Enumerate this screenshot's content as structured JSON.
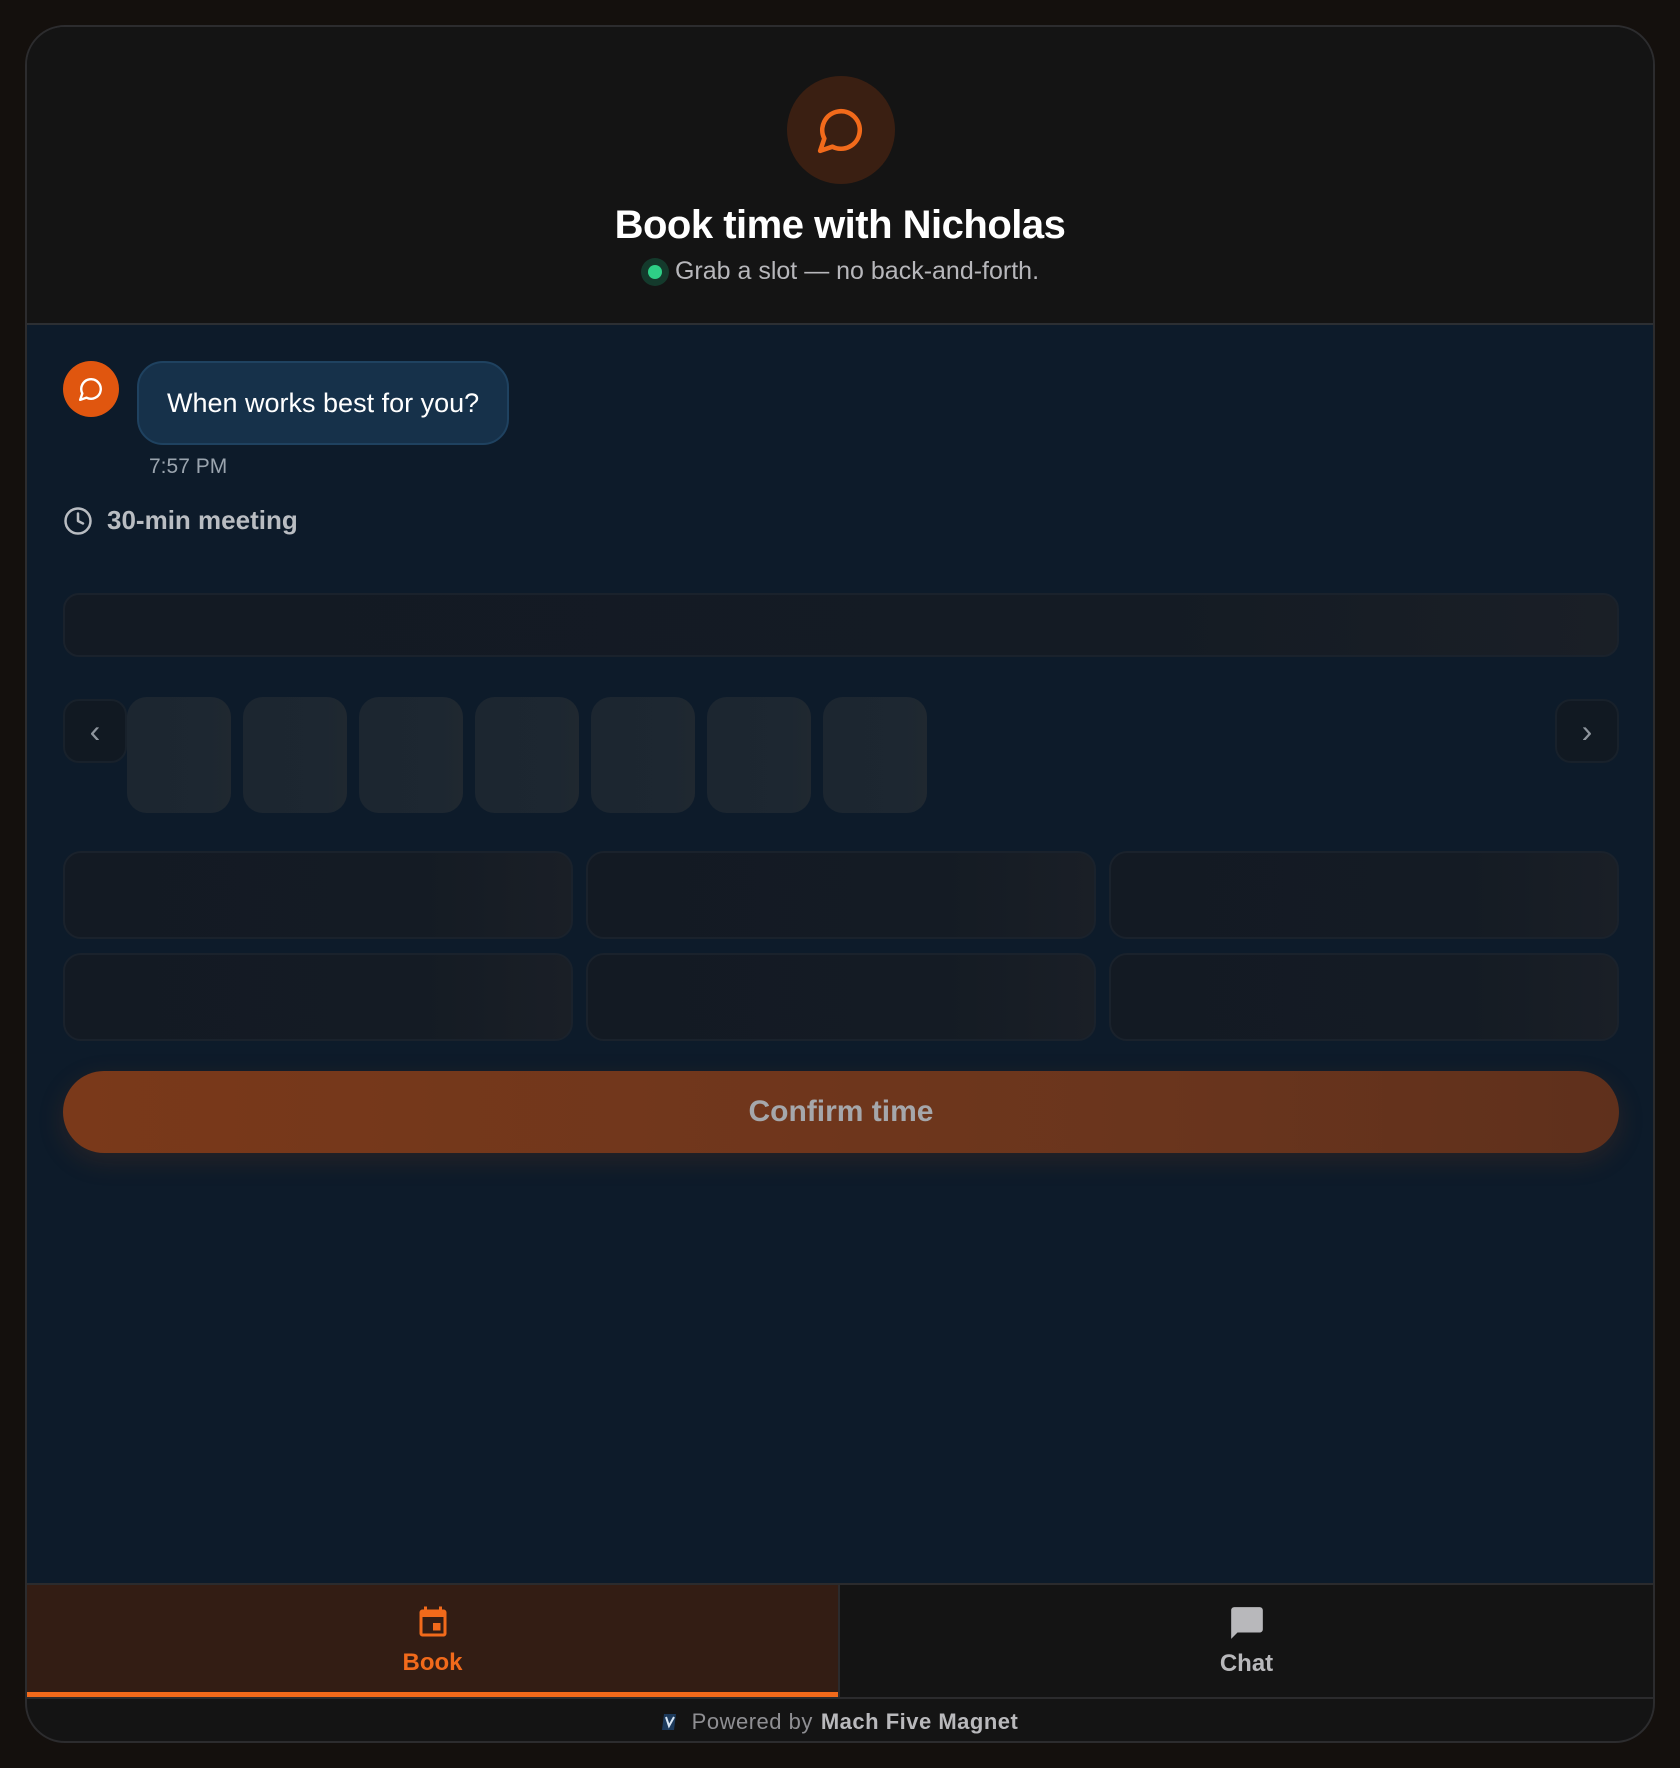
{
  "header": {
    "logo_icon": "chat-bubble-icon",
    "title": "Book time with Nicholas",
    "subtitle": "Grab a slot — no back-and-forth.",
    "status_color": "#2ecf86"
  },
  "chat": {
    "bot_icon": "chat-bubble-icon",
    "message": "When works best for you?",
    "timestamp": "7:57 PM"
  },
  "meeting": {
    "icon": "clock-icon",
    "duration_label": "30-min meeting"
  },
  "date_picker": {
    "prev_glyph": "‹",
    "next_glyph": "›",
    "loading_day_cards": 7,
    "loading_time_slots": 6
  },
  "actions": {
    "confirm_label": "Confirm time"
  },
  "tabs": [
    {
      "label": "Book",
      "icon": "calendar-icon",
      "active": true
    },
    {
      "label": "Chat",
      "icon": "message-icon",
      "active": false
    }
  ],
  "footer": {
    "prefix": "Powered by",
    "brand": "Mach Five Magnet"
  },
  "colors": {
    "accent": "#f26a1b",
    "header_bg": "#141414",
    "main_bg": "#0d1b2a",
    "bubble_bg": "#16314a"
  }
}
